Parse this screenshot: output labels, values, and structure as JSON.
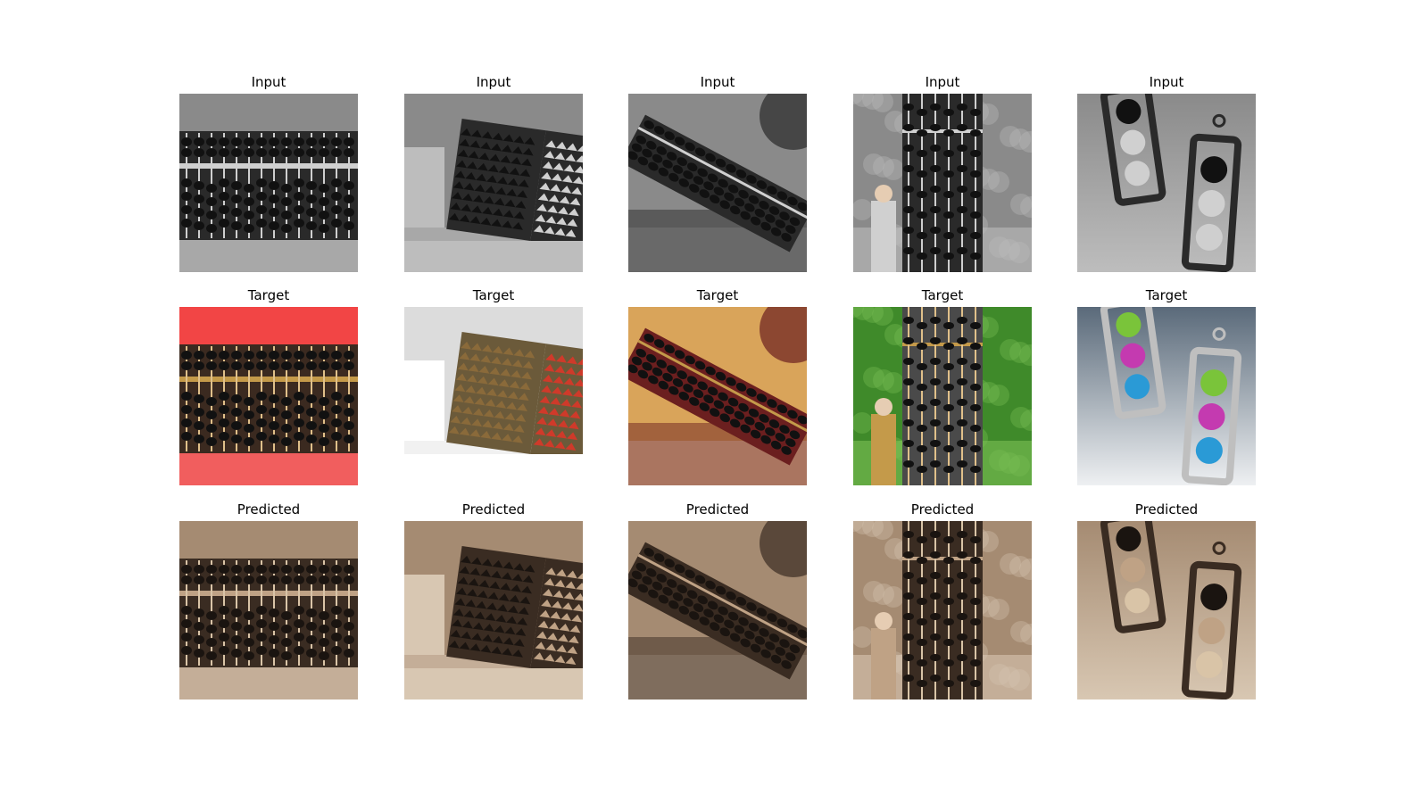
{
  "figure": {
    "row_titles": [
      "Input",
      "Target",
      "Predicted"
    ],
    "columns": [
      {
        "subject": "abacus-closeup",
        "icon": "abacus-icon"
      },
      {
        "subject": "abacus-pair-with-calculator",
        "icon": "abacus-icon"
      },
      {
        "subject": "abacus-on-table-with-basket",
        "icon": "abacus-icon"
      },
      {
        "subject": "giant-abacus-with-woman",
        "icon": "abacus-icon"
      },
      {
        "subject": "felt-ball-earrings",
        "icon": "earring-icon"
      }
    ],
    "palettes": {
      "Input": {
        "bg": "#8a8a8a",
        "bg2": "#bdbdbd",
        "frame": "#2a2a2a",
        "bead": "#111111",
        "accent": "#d0d0d0",
        "rod": "#cfcfcf"
      },
      "Target": {
        "bg": "#e83a3a",
        "bg2": "#7c5a3a",
        "frame": "#3b2a20",
        "bead": "#111111",
        "accent": "#c49a4a",
        "rod": "#e0c08a"
      },
      "Predicted": {
        "bg": "#a58b72",
        "bg2": "#d8c7b2",
        "frame": "#3a2c22",
        "bead": "#1a1410",
        "accent": "#bfa285",
        "rod": "#d9c4a7"
      }
    },
    "target_overrides": [
      {
        "bg": "#f24545",
        "bg2": "#f07070"
      },
      {
        "bg": "#dcdcdc",
        "bg2": "#ffffff",
        "frame": "#6b5a3a",
        "bead": "#8a6a3a",
        "accent": "#cf3a2a"
      },
      {
        "bg": "#d9a45a",
        "bg2": "#f3e6d0",
        "frame": "#6b1f1f"
      },
      {
        "bg": "#3f8a2a",
        "bg2": "#7bbf55",
        "frame": "#4a4a4a"
      },
      {
        "bg": "#5a6a7a",
        "bg2": "#eef0f2",
        "frame": "#bfbfbf",
        "bead": "#7ac43a",
        "accent": "#c43ab0",
        "rod": "#2a9ad6"
      }
    ]
  }
}
